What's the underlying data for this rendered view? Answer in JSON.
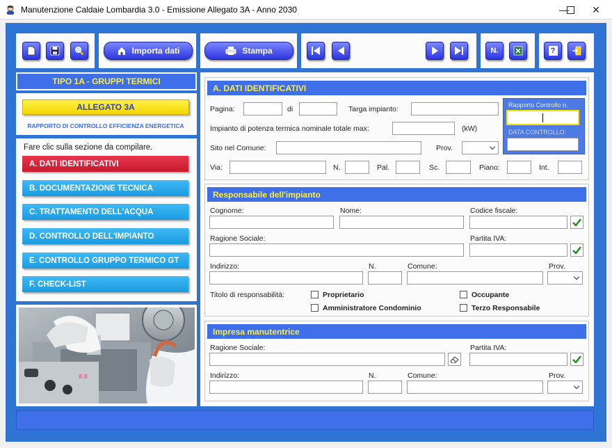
{
  "window": {
    "title": "Manutenzione Caldaie Lombardia 3.0 - Emissione Allegato 3A - Anno 2030",
    "minimize": "—",
    "maximize": "☐",
    "close": "✕"
  },
  "toolbar": {
    "import_label": "Importa dati",
    "print_label": "Stampa",
    "n_label": "N.",
    "help_label": "?"
  },
  "left": {
    "tipo_title": "TIPO 1A - GRUPPI TERMICI",
    "allegato_title": "ALLEGATO 3A",
    "allegato_subtitle": "RAPPORTO DI CONTROLLO EFFICIENZA ENERGETICA",
    "nav_hint": "Fare clic sulla sezione da compilare.",
    "nav_items": [
      {
        "label": "A. DATI IDENTIFICATIVI",
        "active": true
      },
      {
        "label": "B. DOCUMENTAZIONE TECNICA",
        "active": false
      },
      {
        "label": "C. TRATTAMENTO DELL'ACQUA",
        "active": false
      },
      {
        "label": "D. CONTROLLO DELL'IMPIANTO",
        "active": false
      },
      {
        "label": "E. CONTROLLO GRUPPO TERMICO GT",
        "active": false
      },
      {
        "label": "F. CHECK-LIST",
        "active": false
      }
    ]
  },
  "section_a": {
    "title": "A. DATI IDENTIFICATIVI",
    "pagina": "Pagina:",
    "di": "di",
    "targa": "Targa impianto:",
    "potenza": "Impianto di potenza termica nominale totale max:",
    "kw": "(kW)",
    "sito": "Sito nel Comune:",
    "prov": "Prov.",
    "via": "Via:",
    "n": "N.",
    "pal": "Pal.",
    "sc": "Sc.",
    "piano": "Piano:",
    "int": "Int.",
    "rapporto": "Rapporto Controllo n.",
    "data_controllo": "DATA CONTROLLO:"
  },
  "responsabile": {
    "title": "Responsabile dell'impianto",
    "cognome": "Cognome:",
    "nome": "Nome:",
    "codice_fiscale": "Codice fiscale:",
    "ragione_sociale": "Ragione Sociale:",
    "partita_iva": "Partita IVA:",
    "indirizzo": "Indirizzo:",
    "n": "N.",
    "comune": "Comune:",
    "prov": "Prov.",
    "titolo": "Titolo di responsabilità:",
    "opt_proprietario": "Proprietario",
    "opt_occupante": "Occupante",
    "opt_amministratore": "Amministratore Condominio",
    "opt_terzo": "Terzo Responsabile"
  },
  "impresa": {
    "title": "Impresa manutentrice",
    "ragione_sociale": "Ragione Sociale:",
    "partita_iva": "Partita IVA:",
    "indirizzo": "Indirizzo:",
    "n": "N.",
    "comune": "Comune:",
    "prov": "Prov."
  },
  "icons": [
    "new-document-icon",
    "save-icon",
    "search-icon",
    "import-icon",
    "printer-icon",
    "first-record-icon",
    "previous-record-icon",
    "next-record-icon",
    "last-record-icon",
    "excel-icon",
    "help-icon",
    "exit-icon",
    "check-icon",
    "eraser-icon"
  ],
  "colors": {
    "frame_blue": "#2f73d4",
    "header_blue": "#3f6fe8",
    "header_text_yellow": "#ffef3a",
    "nav_cyan": "#1b9be0",
    "nav_active_red": "#c81a30",
    "check_green": "#1c8c1c"
  }
}
